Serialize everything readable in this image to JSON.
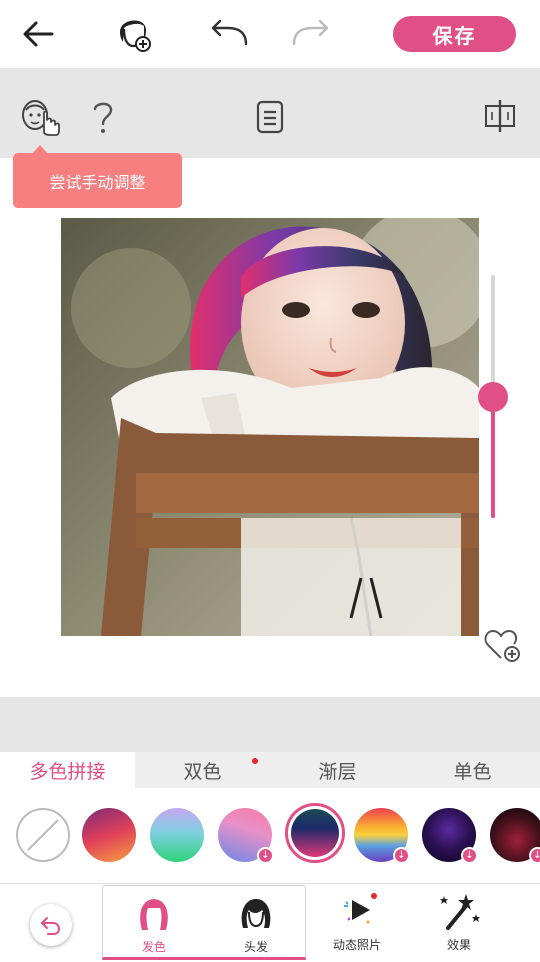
{
  "topbar": {
    "save_label": "保存",
    "icons": [
      "back-arrow-icon",
      "face-add-icon",
      "undo-icon",
      "redo-icon"
    ]
  },
  "toolbar": {
    "icons": [
      "manual-adjust-face-icon",
      "help-icon",
      "document-icon",
      "compare-icon"
    ],
    "tooltip": "尝试手动调整"
  },
  "slider": {
    "level": 0.5,
    "accent": "#e04f85"
  },
  "tabs": [
    {
      "label": "多色拼接",
      "active": true,
      "dot": false
    },
    {
      "label": "双色",
      "active": false,
      "dot": true
    },
    {
      "label": "渐层",
      "active": false,
      "dot": false
    },
    {
      "label": "单色",
      "active": false,
      "dot": false
    }
  ],
  "swatches": [
    {
      "name": "none",
      "selected": false,
      "download": false
    },
    {
      "name": "sunset",
      "selected": false,
      "download": false
    },
    {
      "name": "mint",
      "selected": false,
      "download": false
    },
    {
      "name": "pink-blue",
      "selected": false,
      "download": true
    },
    {
      "name": "teal-pink",
      "selected": true,
      "download": false
    },
    {
      "name": "rainbow",
      "selected": false,
      "download": true
    },
    {
      "name": "purple-night",
      "selected": false,
      "download": true
    },
    {
      "name": "red-night",
      "selected": false,
      "download": true
    }
  ],
  "bottom_nav": {
    "items": [
      {
        "label": "发色",
        "icon": "hair-color-icon",
        "active": true
      },
      {
        "label": "头发",
        "icon": "hair-icon",
        "active": false
      },
      {
        "label": "动态照片",
        "icon": "live-photo-icon",
        "active": false
      },
      {
        "label": "效果",
        "icon": "magic-wand-icon",
        "active": false
      }
    ]
  },
  "colors": {
    "accent": "#e04f85",
    "tooltip": "#f77f80",
    "panel": "#e6e6e6"
  }
}
